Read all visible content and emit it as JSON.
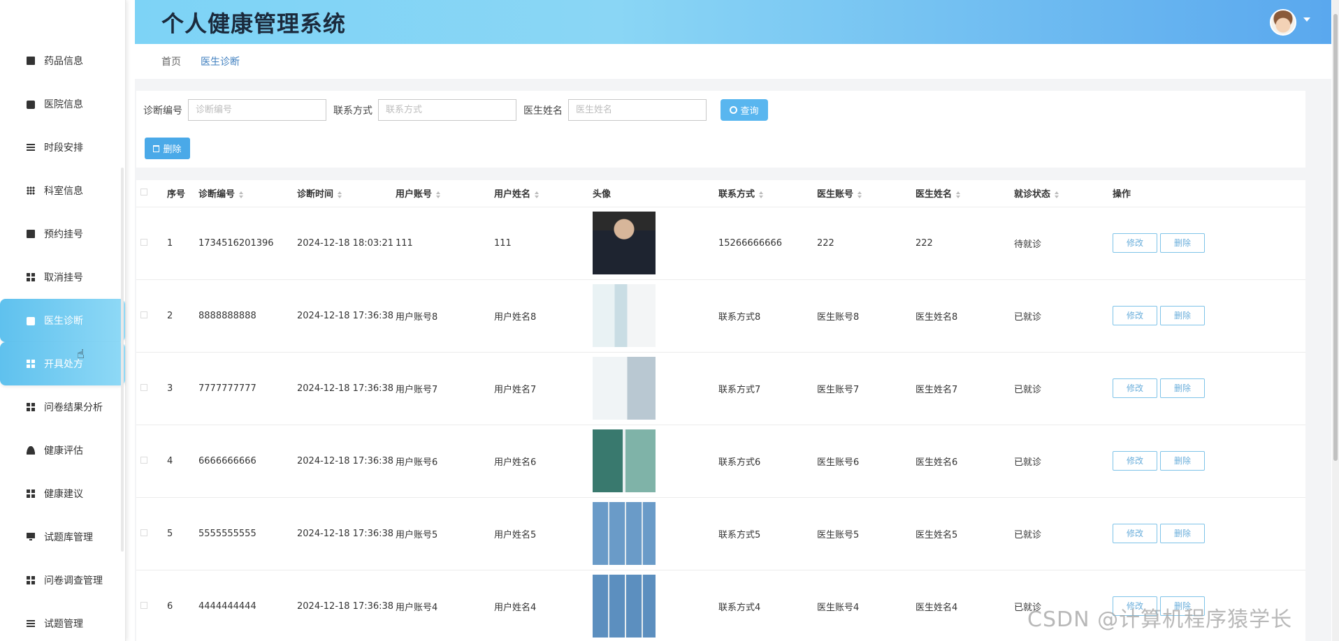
{
  "app": {
    "title": "个人健康管理系统"
  },
  "sidebar": {
    "items": [
      {
        "label": "药品信息",
        "icon": "clipboard-icon"
      },
      {
        "label": "医院信息",
        "icon": "box-icon"
      },
      {
        "label": "时段安排",
        "icon": "sliders-icon"
      },
      {
        "label": "科室信息",
        "icon": "dots-grid-icon"
      },
      {
        "label": "预约挂号",
        "icon": "clipboard-check-icon"
      },
      {
        "label": "取消挂号",
        "icon": "grid-icon"
      },
      {
        "label": "医生诊断",
        "icon": "ticket-icon",
        "active": true
      },
      {
        "label": "开具处方",
        "icon": "grid-icon",
        "hover": true
      },
      {
        "label": "问卷结果分析",
        "icon": "grid-icon"
      },
      {
        "label": "健康评估",
        "icon": "user-icon"
      },
      {
        "label": "健康建议",
        "icon": "grid-icon"
      },
      {
        "label": "试题库管理",
        "icon": "monitor-icon"
      },
      {
        "label": "问卷调查管理",
        "icon": "grid-icon"
      },
      {
        "label": "试题管理",
        "icon": "list-icon"
      }
    ]
  },
  "breadcrumb": {
    "home": "首页",
    "current": "医生诊断"
  },
  "search": {
    "fields": [
      {
        "label": "诊断编号",
        "placeholder": "诊断编号",
        "value": ""
      },
      {
        "label": "联系方式",
        "placeholder": "联系方式",
        "value": ""
      },
      {
        "label": "医生姓名",
        "placeholder": "医生姓名",
        "value": ""
      }
    ],
    "query_label": "查询",
    "delete_label": "删除"
  },
  "table": {
    "columns": [
      "序号",
      "诊断编号",
      "诊断时间",
      "用户账号",
      "用户姓名",
      "头像",
      "联系方式",
      "医生账号",
      "医生姓名",
      "就诊状态",
      "操作"
    ],
    "edit_label": "修改",
    "delete_label": "删除",
    "rows": [
      {
        "no": "1",
        "code": "1734516201396",
        "time": "2024-12-18 18:03:21",
        "user_account": "111",
        "user_name": "111",
        "avatar": "photo-man-suit",
        "contact": "15266666666",
        "doctor_account": "222",
        "doctor_name": "222",
        "status": "待就诊"
      },
      {
        "no": "2",
        "code": "8888888888",
        "time": "2024-12-18 17:36:38",
        "user_account": "用户账号8",
        "user_name": "用户姓名8",
        "avatar": "photo-hospital-hall",
        "contact": "联系方式8",
        "doctor_account": "医生账号8",
        "doctor_name": "医生姓名8",
        "status": "已就诊"
      },
      {
        "no": "3",
        "code": "7777777777",
        "time": "2024-12-18 17:36:38",
        "user_account": "用户账号7",
        "user_name": "用户姓名7",
        "avatar": "photo-nurse",
        "contact": "联系方式7",
        "doctor_account": "医生账号7",
        "doctor_name": "医生姓名7",
        "status": "已就诊"
      },
      {
        "no": "4",
        "code": "6666666666",
        "time": "2024-12-18 17:36:38",
        "user_account": "用户账号6",
        "user_name": "用户姓名6",
        "avatar": "photo-ward",
        "contact": "联系方式6",
        "doctor_account": "医生账号6",
        "doctor_name": "医生姓名6",
        "status": "已就诊"
      },
      {
        "no": "5",
        "code": "5555555555",
        "time": "2024-12-18 17:36:38",
        "user_account": "用户账号5",
        "user_name": "用户姓名5",
        "avatar": "photo-corridor-grid",
        "contact": "联系方式5",
        "doctor_account": "医生账号5",
        "doctor_name": "医生姓名5",
        "status": "已就诊"
      },
      {
        "no": "6",
        "code": "4444444444",
        "time": "2024-12-18 17:36:38",
        "user_account": "用户账号4",
        "user_name": "用户姓名4",
        "avatar": "photo-corridor-grid",
        "contact": "联系方式4",
        "doctor_account": "医生账号4",
        "doctor_name": "医生姓名4",
        "status": "已就诊"
      }
    ]
  },
  "watermark": "CSDN @计算机程序猿学长",
  "colors": {
    "accent": "#59b6ef",
    "header_start": "#7dd3f6",
    "header_end": "#5aa8ee",
    "active_menu": "#5fc1ee"
  }
}
